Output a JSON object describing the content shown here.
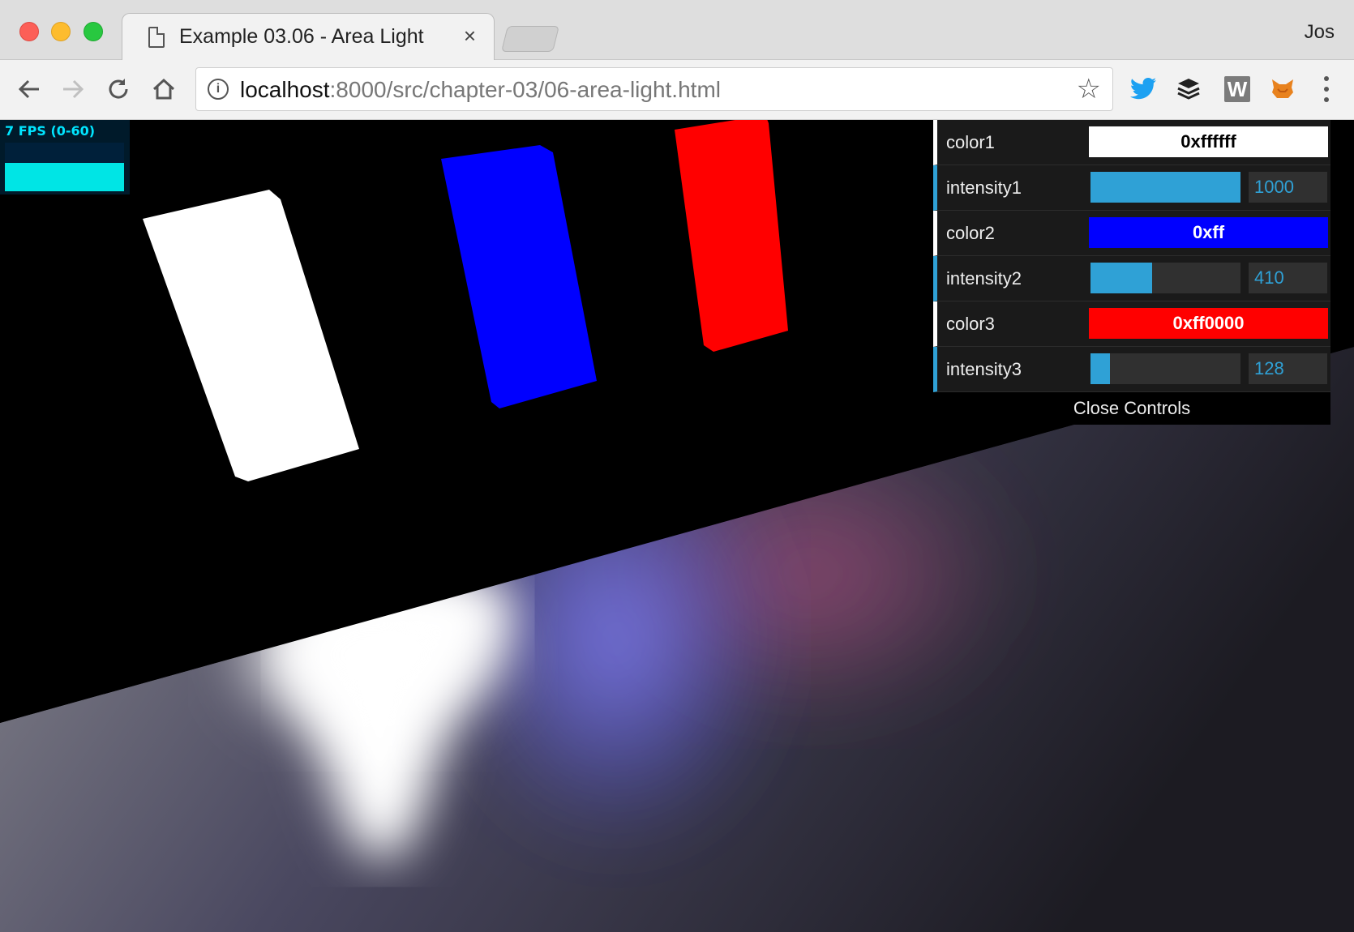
{
  "browser": {
    "tab_title": "Example 03.06 - Area Light",
    "tab_close": "×",
    "profile_name": "Jos",
    "url_host": "localhost",
    "url_rest": ":8000/src/chapter-03/06-area-light.html",
    "icons": {
      "back": "back-arrow-icon",
      "forward": "forward-arrow-icon",
      "reload": "reload-icon",
      "home": "home-icon",
      "info": "info-icon",
      "bookmark": "star-icon",
      "twitter": "twitter-icon",
      "buffer": "buffer-icon",
      "w_extension": "w-extension-icon",
      "metamask": "fox-icon",
      "menu": "three-dots-icon"
    },
    "w_extension_letter": "W"
  },
  "stats": {
    "label": "7 FPS (0-60)",
    "fill_fraction": 0.58
  },
  "gui": {
    "rows": [
      {
        "type": "color",
        "label": "color1",
        "value": "0xffffff",
        "swatch": "#ffffff",
        "text_color": "#000000"
      },
      {
        "type": "number",
        "label": "intensity1",
        "value": "1000",
        "fraction": 1.0
      },
      {
        "type": "color",
        "label": "color2",
        "value": "0xff",
        "swatch": "#0000ff",
        "text_color": "#ffffff"
      },
      {
        "type": "number",
        "label": "intensity2",
        "value": "410",
        "fraction": 0.41
      },
      {
        "type": "color",
        "label": "color3",
        "value": "0xff0000",
        "swatch": "#ff0000",
        "text_color": "#ffffff"
      },
      {
        "type": "number",
        "label": "intensity3",
        "value": "128",
        "fraction": 0.128
      }
    ],
    "close_label": "Close Controls"
  },
  "scene": {
    "colors": {
      "light1": "#ffffff",
      "light2": "#0000ff",
      "light3": "#ff0000",
      "wall": "#000000",
      "floor": "#2a2833"
    }
  }
}
